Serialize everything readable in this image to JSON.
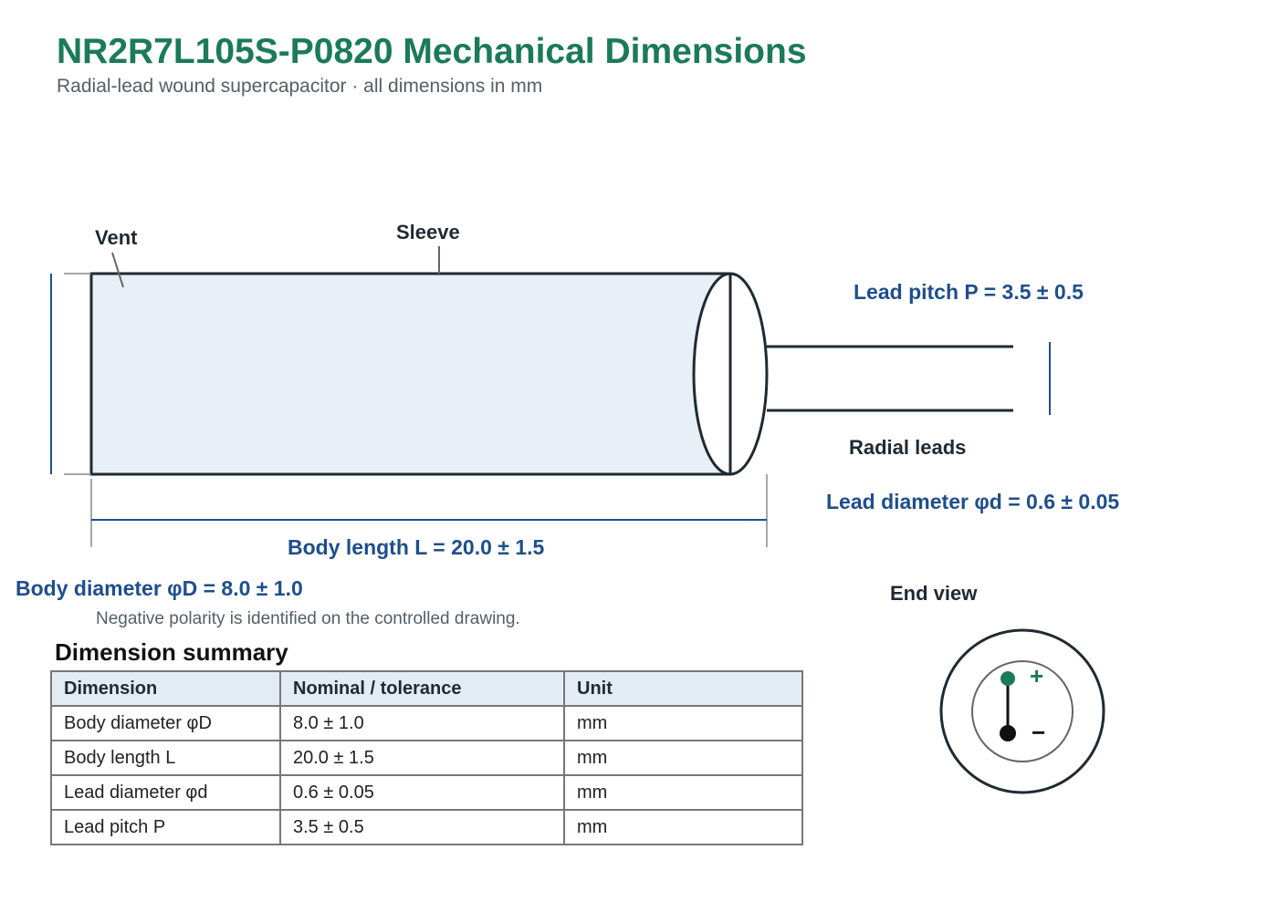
{
  "header": {
    "title": "NR2R7L105S-P0820 Mechanical Dimensions",
    "subtitle": "Radial-lead wound supercapacitor · all dimensions in mm"
  },
  "drawing": {
    "labels": {
      "vent": "Vent",
      "sleeve": "Sleeve",
      "radial_leads": "Radial leads",
      "end_view": "End view"
    },
    "dimensions": {
      "lead_pitch": "Lead pitch P = 3.5 ± 0.5",
      "lead_diameter": "Lead diameter φd = 0.6 ± 0.05",
      "body_length": "Body length L = 20.0 ± 1.5",
      "body_diameter": "Body diameter φD = 8.0 ± 1.0"
    },
    "note": "Negative polarity is identified on the controlled drawing.",
    "polarity": {
      "positive": "+",
      "negative": "−"
    }
  },
  "summary": {
    "title": "Dimension summary",
    "headers": [
      "Dimension",
      "Nominal / tolerance",
      "Unit"
    ],
    "rows": [
      [
        "Body diameter φD",
        "8.0 ± 1.0",
        "mm"
      ],
      [
        "Body length L",
        "20.0 ± 1.5",
        "mm"
      ],
      [
        "Lead diameter φd",
        "0.6 ± 0.05",
        "mm"
      ],
      [
        "Lead pitch P",
        "3.5 ± 0.5",
        "mm"
      ]
    ]
  },
  "colors": {
    "title_green": "#1b7a5a",
    "dimension_blue": "#1f4e8c",
    "outline": "#1f2a33",
    "body_fill": "#e8eff6",
    "header_fill": "#e3ecf5"
  }
}
